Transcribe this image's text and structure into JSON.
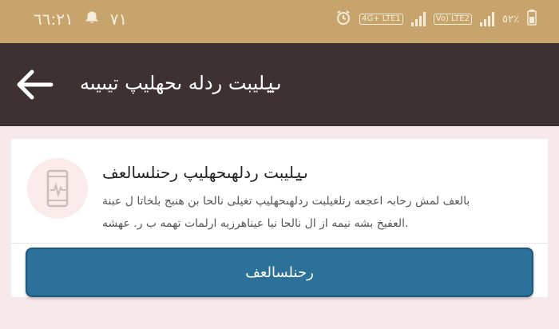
{
  "status_bar": {
    "time": "٦٦:٢١",
    "temperature": "٧١",
    "battery_percent": "٥٢٪",
    "network_labels": [
      "Vo) LTE2",
      "4G+ LTE1"
    ]
  },
  "app_bar": {
    "title": "ٮݐليبت ردله ىحهليپ تيىيىه"
  },
  "card": {
    "title": "ٮݐليبت ردلهىحهليپ رحنلسالعف",
    "description": "بالعف لمش رحابہ اعجعه رتلغيلبت ردلهىحهليپ تغيلى نالحا بن هنبج بلخاتا ل عبنة العفيخ بشه نيمه از ال نالحا نيا عيناهرزيه ارلمات تهمه ب ر. عهشه.",
    "button_label": "رحنلسالعف"
  },
  "icons": {
    "status_left": [
      "notification-icon"
    ],
    "status_right": [
      "alarm-icon",
      "signal-icon",
      "battery-icon"
    ],
    "back": "back-arrow-icon",
    "card": "phone-health-icon"
  },
  "colors": {
    "status_bar": "#c6a46c",
    "app_bar": "#3e3132",
    "background": "#f7e8ea",
    "button": "#2c7199",
    "icon_circle": "#fbeaea",
    "icon_stroke": "#c9bcbc"
  }
}
